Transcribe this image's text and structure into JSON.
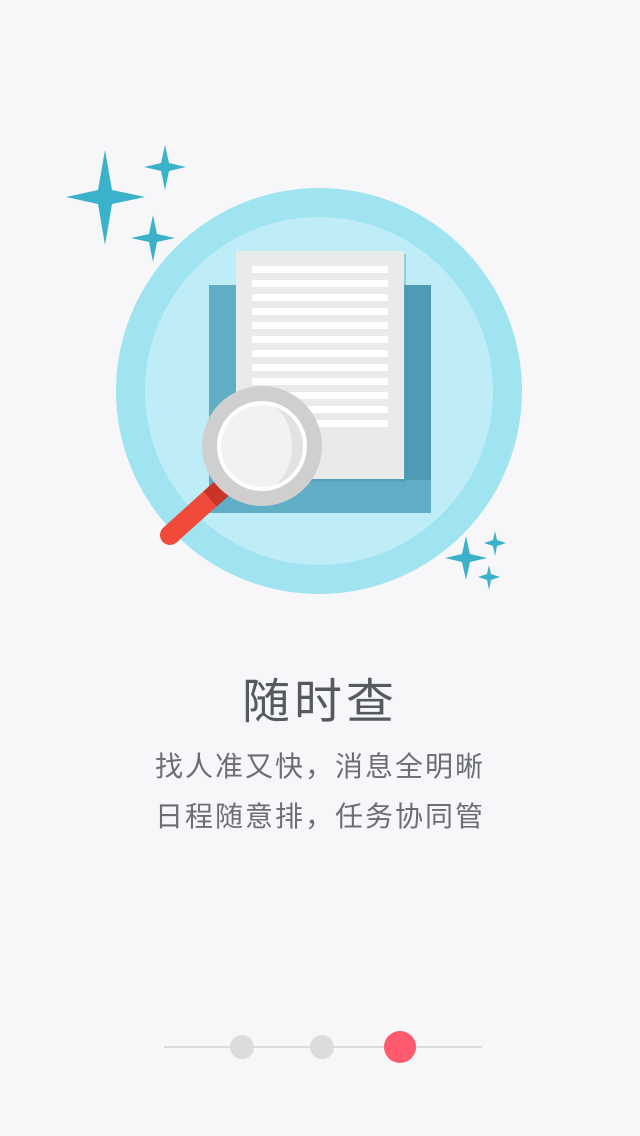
{
  "page": {
    "title": "随时查",
    "subtitle_line1": "找人准又快，消息全明晰",
    "subtitle_line2": "日程随意排，任务协同管"
  },
  "illustration": {
    "icons": [
      "sparkle-icon",
      "document-icon",
      "magnifier-icon"
    ],
    "colors": {
      "outer_circle": "#a0e4f1",
      "inner_circle": "#bfedf7",
      "folder": "#5faec6",
      "paper": "#e8ebe9",
      "sparkle": "#3ab2c9",
      "magnifier_rim": "#cfcfcf",
      "magnifier_handle": "#f04a3a"
    }
  },
  "pager": {
    "total": 3,
    "active_index": 3,
    "colors": {
      "inactive": "#dcdcdf",
      "active": "#ff5a6e"
    }
  }
}
